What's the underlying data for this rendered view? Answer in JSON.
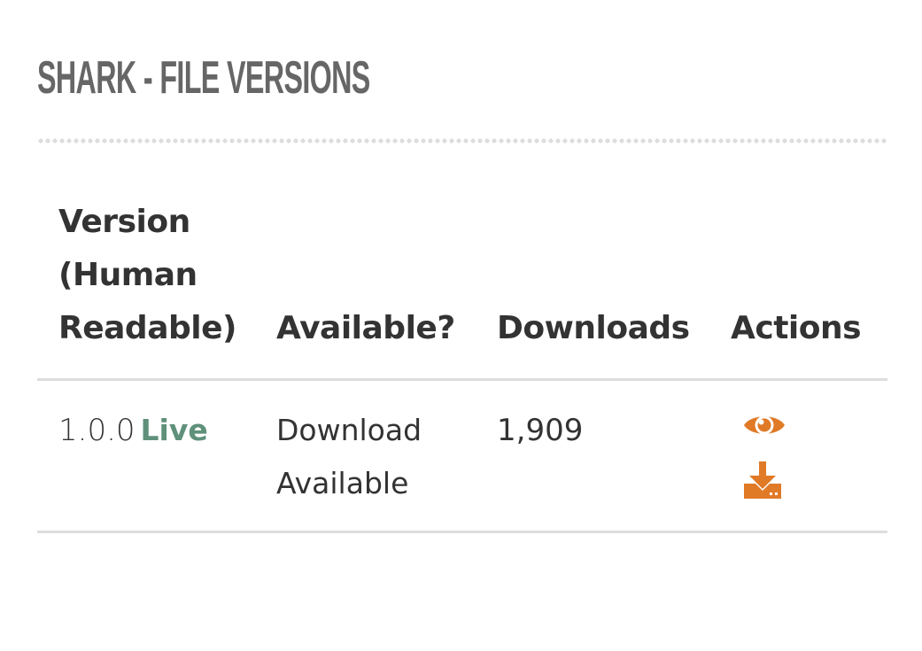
{
  "page": {
    "title": "SHARK - FILE VERSIONS"
  },
  "table": {
    "headers": {
      "version": "Version (Human Readable)",
      "available": "Available?",
      "downloads": "Downloads",
      "actions": "Actions"
    },
    "rows": [
      {
        "version": "1.0.0",
        "badge": "Live",
        "available": "Download Available",
        "downloads": "1,909",
        "actions": [
          {
            "icon": "eye-icon",
            "label": "view"
          },
          {
            "icon": "download-icon",
            "label": "download"
          }
        ]
      }
    ]
  },
  "colors": {
    "title": "#666666",
    "text": "#333333",
    "live_badge": "#5f917a",
    "action_icons": "#e07a27",
    "dividers": "#dddddd"
  }
}
